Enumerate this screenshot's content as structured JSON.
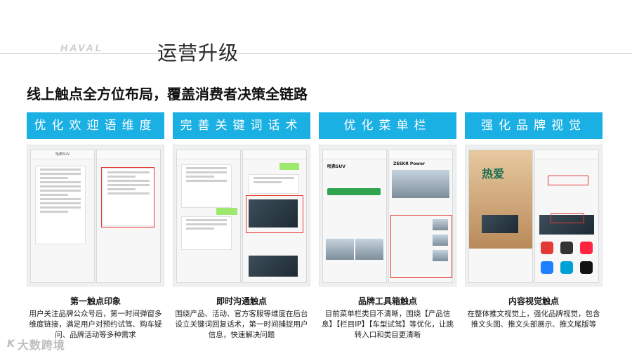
{
  "brand": "HAVAL",
  "page_title": "运营升级",
  "subtitle": "线上触点全方位布局，覆盖消费者决策全链路",
  "columns": [
    {
      "header": "优化欢迎语维度",
      "caption_title": "第一触点印象",
      "caption_body": "用户关注品牌公众号后，第一时间弹窗多维度链接，满足用户对预约试驾、购车疑问、品牌活动等多种需求"
    },
    {
      "header": "完善关键词话术",
      "caption_title": "即时沟通触点",
      "caption_body": "围绕产品、活动、官方客服等维度在后台设立关键词回复话术，第一时间捕捉用户信息，快速解决问题"
    },
    {
      "header": "优化菜单栏",
      "caption_title": "品牌工具箱触点",
      "caption_body": "目前菜单栏类目不清晰，围绕【产品信息】【栏目IP】【车型试驾】等优化，让跳转入口和类目更清晰"
    },
    {
      "header": "强化品牌视觉",
      "caption_title": "内容视觉触点",
      "caption_body": "在整体推文视觉上，强化品牌视觉，包含推文头图、推文头部展示、推文尾版等"
    }
  ],
  "screens": {
    "chat_title": "哈弗SUV",
    "menu_brand": "哈弗SUV",
    "menu_product": "ZEEKR Power",
    "poster_text": "热爱"
  },
  "footer": {
    "logo_mark": "K",
    "logo_name": "大数跨境"
  }
}
